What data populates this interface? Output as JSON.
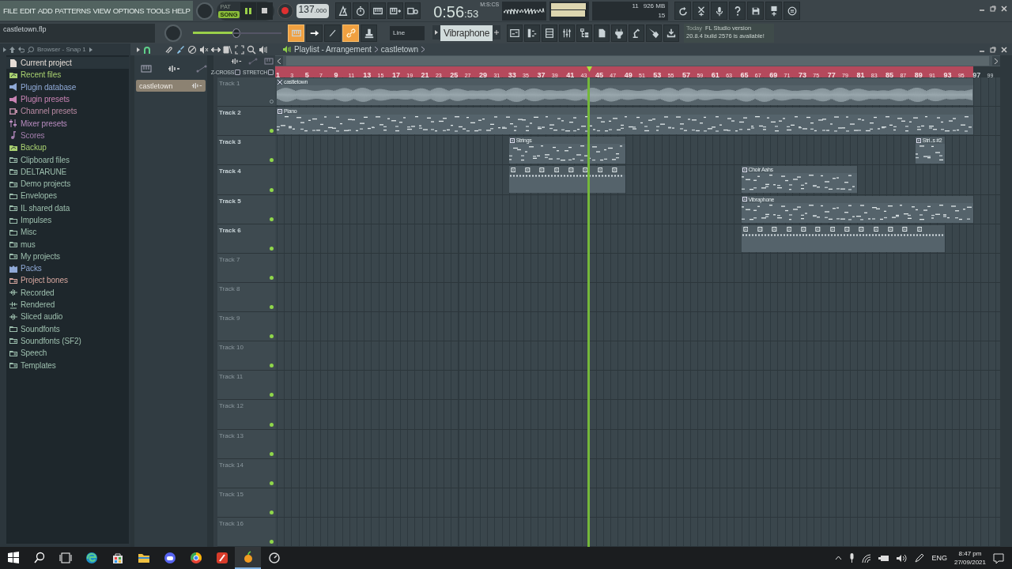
{
  "menu": [
    "FILE",
    "EDIT",
    "ADD",
    "PATTERNS",
    "VIEW",
    "OPTIONS",
    "TOOLS",
    "HELP"
  ],
  "hint_bar": {
    "text": "castletown.flp"
  },
  "transport": {
    "modes": [
      {
        "label": "PAT",
        "selected": false
      },
      {
        "label": "SONG",
        "selected": true
      }
    ]
  },
  "tempo": {
    "whole": "137",
    "fraction": ".000"
  },
  "time": {
    "main": "0:56",
    "sub": ":53",
    "unit": "M:S:CS"
  },
  "meters": [
    {
      "level": 0.95
    },
    {
      "level": 0.92
    }
  ],
  "cpu": {
    "cpu": "11",
    "memory": "926 MB",
    "polyphony": "15"
  },
  "pitch_slider": {
    "level": 0.45
  },
  "toggles": [
    {
      "on": true
    },
    {
      "on": false
    },
    {
      "on": false
    },
    {
      "on": true
    },
    {
      "on": false
    }
  ],
  "snap": "Line",
  "pattern": "Vibraphone",
  "news": {
    "date": "Today",
    "title": "FL Studio version",
    "body": "20.8.4 build 2576 is available!"
  },
  "browser": {
    "title": "Browser - Snap 1",
    "items": [
      {
        "label": "Current project",
        "kind": "file",
        "color": "#e6ddd6",
        "selected": true
      },
      {
        "label": "Recent files",
        "kind": "folder-link",
        "color": "#a8d070",
        "selected": false
      },
      {
        "label": "Plugin database",
        "kind": "plugin",
        "color": "#8fa9d6",
        "selected": false
      },
      {
        "label": "Plugin presets",
        "kind": "plugin",
        "color": "#c883b3",
        "selected": false
      },
      {
        "label": "Channel presets",
        "kind": "channel",
        "color": "#b98aa3",
        "selected": false
      },
      {
        "label": "Mixer presets",
        "kind": "mixer",
        "color": "#b98cc0",
        "selected": false
      },
      {
        "label": "Scores",
        "kind": "note",
        "color": "#a47fae",
        "selected": false
      },
      {
        "label": "Backup",
        "kind": "folder-link",
        "color": "#a8d070",
        "selected": false
      },
      {
        "label": "Clipboard files",
        "kind": "folder-plus",
        "color": "#9dbfae",
        "selected": false
      },
      {
        "label": "DELTARUNE",
        "kind": "folder-plus",
        "color": "#9dbfae",
        "selected": false
      },
      {
        "label": "Demo projects",
        "kind": "folder-plus",
        "color": "#9dbfae",
        "selected": false
      },
      {
        "label": "Envelopes",
        "kind": "folder",
        "color": "#9dbfae",
        "selected": false
      },
      {
        "label": "IL shared data",
        "kind": "folder-plus",
        "color": "#9dbfae",
        "selected": false
      },
      {
        "label": "Impulses",
        "kind": "folder",
        "color": "#9dbfae",
        "selected": false
      },
      {
        "label": "Misc",
        "kind": "folder",
        "color": "#9dbfae",
        "selected": false
      },
      {
        "label": "mus",
        "kind": "folder-plus",
        "color": "#9dbfae",
        "selected": false
      },
      {
        "label": "My projects",
        "kind": "folder-plus",
        "color": "#9dbfae",
        "selected": false
      },
      {
        "label": "Packs",
        "kind": "packs",
        "color": "#8fa9d6",
        "selected": false
      },
      {
        "label": "Project bones",
        "kind": "folder-plus",
        "color": "#d6a79f",
        "selected": false
      },
      {
        "label": "Recorded",
        "kind": "audio",
        "color": "#9dbfae",
        "selected": false
      },
      {
        "label": "Rendered",
        "kind": "rendered",
        "color": "#9dbfae",
        "selected": false
      },
      {
        "label": "Sliced audio",
        "kind": "audio",
        "color": "#9dbfae",
        "selected": false
      },
      {
        "label": "Soundfonts",
        "kind": "folder",
        "color": "#9dbfae",
        "selected": false
      },
      {
        "label": "Soundfonts (SF2)",
        "kind": "folder-plus",
        "color": "#9dbfae",
        "selected": false
      },
      {
        "label": "Speech",
        "kind": "folder-plus",
        "color": "#9dbfae",
        "selected": false
      },
      {
        "label": "Templates",
        "kind": "folder-plus",
        "color": "#9dbfae",
        "selected": false
      }
    ]
  },
  "picker": {
    "items": [
      {
        "label": "castletown",
        "selected": true
      }
    ]
  },
  "playlist": {
    "title": "Playlist - Arrangement",
    "pattern": "castletown",
    "options": [
      {
        "label": "Z-CROSS",
        "checked": false
      },
      {
        "label": "STRETCH",
        "checked": false
      }
    ],
    "ruler": [
      "1",
      "3",
      "5",
      "7",
      "9",
      "11",
      "13",
      "15",
      "17",
      "19",
      "21",
      "23",
      "25",
      "27",
      "29",
      "31",
      "33",
      "35",
      "37",
      "39",
      "41",
      "43",
      "45",
      "47",
      "49",
      "51",
      "53",
      "55",
      "57",
      "59",
      "61",
      "63",
      "65",
      "67",
      "69",
      "71",
      "73",
      "75",
      "77",
      "79",
      "81",
      "83",
      "85",
      "87",
      "89",
      "91",
      "93",
      "95",
      "97",
      "99"
    ],
    "playhead": {
      "level": 0.431
    },
    "tracks": [
      {
        "name": "Track 1",
        "dimmed": true,
        "enabled": false,
        "clips": [
          {
            "kind": "audio",
            "name": "castletown"
          }
        ]
      },
      {
        "name": "Track 2",
        "dimmed": false,
        "enabled": true,
        "clips": [
          {
            "kind": "pattern",
            "name": "Piano"
          }
        ]
      },
      {
        "name": "Track 3",
        "dimmed": false,
        "enabled": true,
        "clips": [
          {
            "kind": "pattern",
            "name": "Strings"
          },
          {
            "kind": "pattern",
            "name": "Stri..s #2"
          }
        ]
      },
      {
        "name": "Track 4",
        "dimmed": false,
        "enabled": true,
        "clips": [
          {
            "kind": "steps"
          },
          {
            "kind": "pattern",
            "name": "Choir Aahs"
          }
        ]
      },
      {
        "name": "Track 5",
        "dimmed": false,
        "enabled": true,
        "clips": [
          {
            "kind": "pattern",
            "name": "Vibraphone"
          }
        ]
      },
      {
        "name": "Track 6",
        "dimmed": false,
        "enabled": true,
        "clips": [
          {
            "kind": "steps"
          }
        ]
      },
      {
        "name": "Track 7",
        "dimmed": true,
        "enabled": true
      },
      {
        "name": "Track 8",
        "dimmed": true,
        "enabled": true
      },
      {
        "name": "Track 9",
        "dimmed": true,
        "enabled": true
      },
      {
        "name": "Track 10",
        "dimmed": true,
        "enabled": true
      },
      {
        "name": "Track 11",
        "dimmed": true,
        "enabled": true
      },
      {
        "name": "Track 12",
        "dimmed": true,
        "enabled": true
      },
      {
        "name": "Track 13",
        "dimmed": true,
        "enabled": true
      },
      {
        "name": "Track 14",
        "dimmed": true,
        "enabled": true
      },
      {
        "name": "Track 15",
        "dimmed": true,
        "enabled": true
      },
      {
        "name": "Track 16",
        "dimmed": true,
        "enabled": true
      }
    ]
  },
  "taskbar": {
    "language": "ENG",
    "time": "8:47 pm",
    "date": "27/09/2021"
  }
}
